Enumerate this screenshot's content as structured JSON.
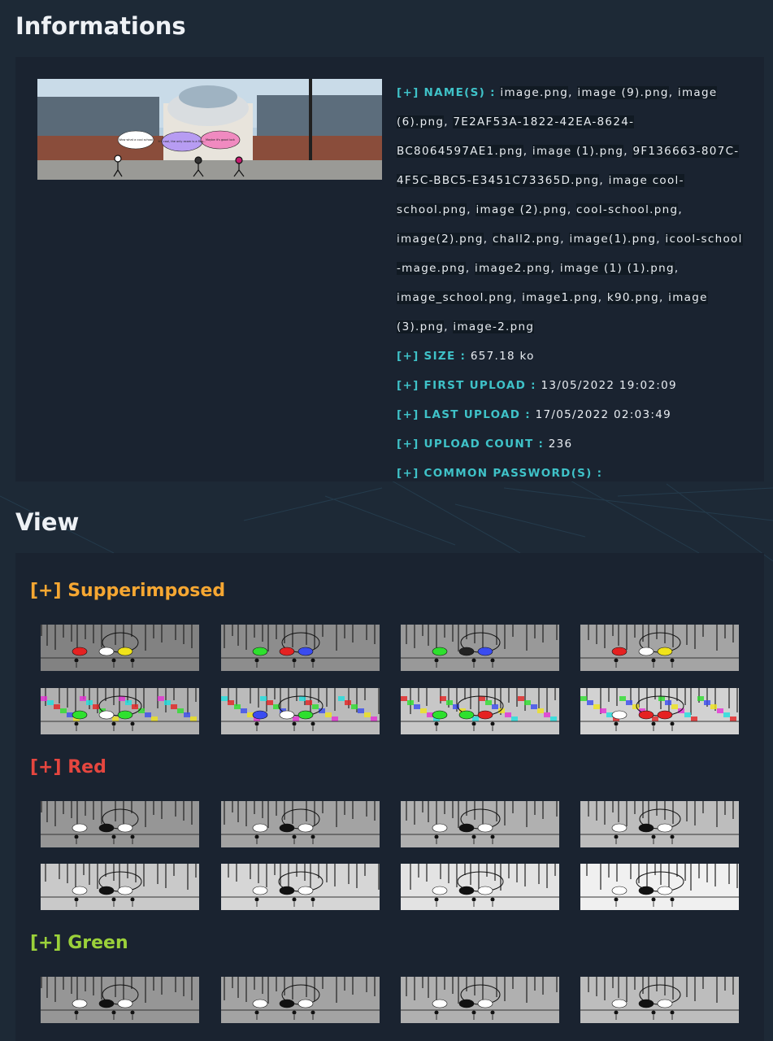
{
  "sections": {
    "informations_title": "Informations",
    "view_title": "View"
  },
  "info": {
    "name_label": "[+] NAME(S) :",
    "names": [
      "image.png",
      "image (9).png",
      "image (6).png",
      "7E2AF53A-1822-42EA-8624-BC8064597AE1.png",
      "image (1).png",
      "9F136663-807C-4F5C-BBC5-E3451C73365D.png",
      "image cool-school.png",
      "image (2).png",
      "cool-school.png",
      "image(2).png",
      "chall2.png",
      "image(1).png",
      "icool-school -mage.png",
      "image2.png",
      "image (1) (1).png",
      "image_school.png",
      "image1.png",
      "k90.png",
      "image (3).png",
      "image-2.png"
    ],
    "size_label": "[+] SIZE :",
    "size": "657.18 ko",
    "first_upload_label": "[+] FIRST UPLOAD :",
    "first_upload": "13/05/2022 19:02:09",
    "last_upload_label": "[+] LAST UPLOAD :",
    "last_upload": "17/05/2022 02:03:49",
    "upload_count_label": "[+] UPLOAD COUNT :",
    "upload_count": "236",
    "passwords_label": "[+] COMMON PASSWORD(S) :"
  },
  "hero_bubbles": [
    "Wow what a cool school",
    "It's cool, the only exam is a flag...",
    "Maybe it's good luck"
  ],
  "view": {
    "groups": [
      {
        "label": "[+] Supperimposed",
        "color": "#f6a732",
        "kind": "superimposed",
        "thumbs": 8
      },
      {
        "label": "[+] Red",
        "color": "#e5463f",
        "kind": "red",
        "thumbs": 8
      },
      {
        "label": "[+] Green",
        "color": "#9bd13a",
        "kind": "green",
        "thumbs": 4
      }
    ]
  },
  "colors": {
    "background": "#1d2936",
    "panel": "#1a2330",
    "label_cyan": "#3fc2c8"
  }
}
